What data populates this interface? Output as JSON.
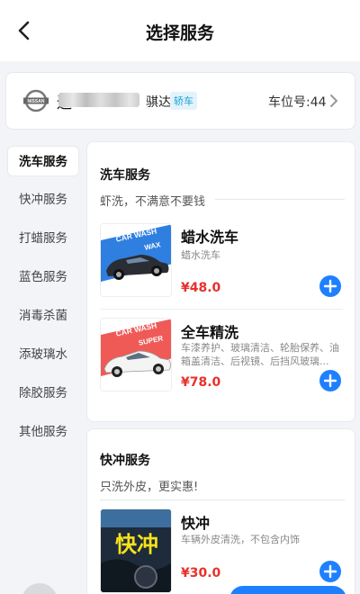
{
  "header": {
    "title": "选择服务"
  },
  "vehicle": {
    "plate_first_char": "辽",
    "model": "骐达",
    "type_badge": "轿车",
    "parking_space": "车位号:44"
  },
  "sidebar": {
    "items": [
      {
        "label": "洗车服务",
        "active": true
      },
      {
        "label": "快冲服务",
        "active": false
      },
      {
        "label": "打蜡服务",
        "active": false
      },
      {
        "label": "蓝色服务",
        "active": false
      },
      {
        "label": "消毒杀菌",
        "active": false
      },
      {
        "label": "添玻璃水",
        "active": false
      },
      {
        "label": "除胶服务",
        "active": false
      },
      {
        "label": "其他服务",
        "active": false
      }
    ]
  },
  "sections": [
    {
      "title": "洗车服务",
      "subtitle": "虾洗，不满意不要钱",
      "items": [
        {
          "name": "蜡水洗车",
          "desc": "蜡水洗车",
          "price": "¥48.0",
          "thumb_line1": "CAR WASH",
          "thumb_line2": "WAX",
          "thumb_color": "#2f7fe0"
        },
        {
          "name": "全车精洗",
          "desc": "车漆养护、玻璃清洁、轮胎保养、油箱盖清洁、后视镜、后挡风玻璃...",
          "price": "¥78.0",
          "thumb_line1": "CAR WASH",
          "thumb_line2": "SUPER",
          "thumb_color": "#ef5a57"
        }
      ]
    },
    {
      "title": "快冲服务",
      "subtitle": "只洗外皮，更实惠!",
      "items": [
        {
          "name": "快冲",
          "desc": "车辆外皮清洗，不包含内饰",
          "price": "¥30.0",
          "thumb_text": "快冲"
        }
      ]
    }
  ],
  "colors": {
    "accent": "#1e80ff",
    "price": "#e8312b",
    "badge": "#1aa3d9"
  },
  "icons": {
    "back": "chevron-left-icon",
    "forward": "chevron-right-icon",
    "add": "plus-circle-icon",
    "brand": "nissan-logo"
  }
}
